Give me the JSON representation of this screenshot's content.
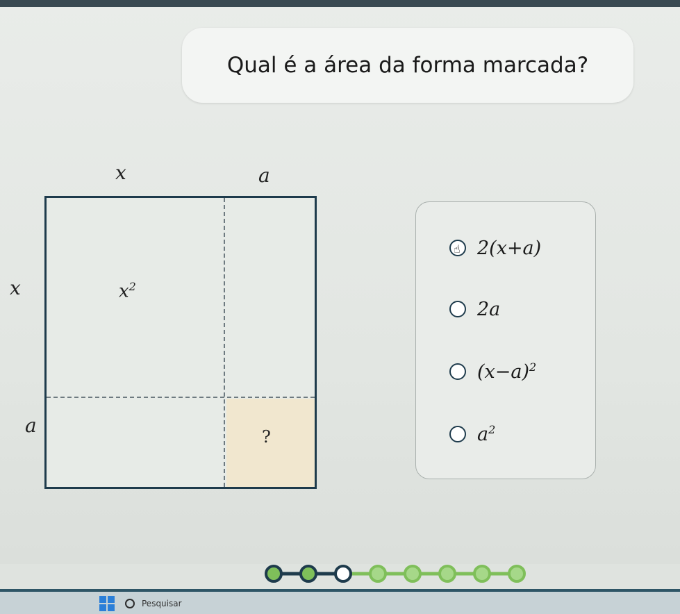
{
  "question": {
    "text": "Qual é a área da forma marcada?"
  },
  "diagram": {
    "top_labels": [
      "x",
      "a"
    ],
    "side_labels": [
      "x",
      "a"
    ],
    "region_x_squared_base": "x",
    "region_x_squared_exp": "2",
    "unknown_region_label": "?",
    "shaded_color": "#f1e7cf",
    "border_color": "#1e3b4c"
  },
  "options": [
    {
      "label": "2(x+a)",
      "selected": false
    },
    {
      "label": "2a",
      "selected": false
    },
    {
      "label": "(x−a)",
      "exp": "2",
      "selected": false
    },
    {
      "label": "a",
      "exp": "2",
      "selected": false
    }
  ],
  "cursor": {
    "icon": "hand-pointer-icon"
  },
  "progress": {
    "total_steps": 8,
    "current_step": 3,
    "color_done": "#1e3b4c",
    "color_todo": "#7fbf5a"
  },
  "taskbar": {
    "search_placeholder": "Pesquisar",
    "start_icon": "windows-start-icon",
    "search_icon": "search-icon"
  }
}
